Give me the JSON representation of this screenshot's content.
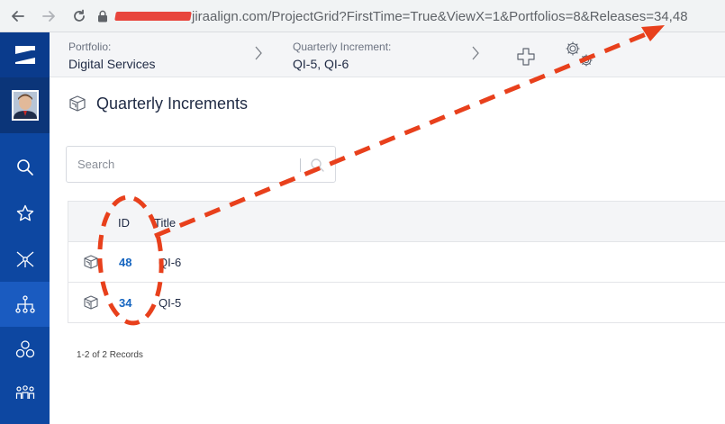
{
  "browser": {
    "url_domain": "jiraalign.com",
    "url_path": "/ProjectGrid?FirstTime=True&ViewX=1&Portfolios=8&Releases=34,48"
  },
  "breadcrumb": {
    "portfolio_label": "Portfolio:",
    "portfolio_value": "Digital Services",
    "qi_label": "Quarterly Increment:",
    "qi_value": "QI-5, QI-6"
  },
  "page": {
    "title": "Quarterly Increments"
  },
  "search": {
    "placeholder": "Search",
    "value": ""
  },
  "table": {
    "headers": {
      "id": "ID",
      "title": "Title"
    },
    "rows": [
      {
        "id": "48",
        "title": "QI-6"
      },
      {
        "id": "34",
        "title": "QI-5"
      }
    ],
    "records_text": "1-2 of 2 Records"
  },
  "sidebar": {
    "items": [
      {
        "icon": "search-icon"
      },
      {
        "icon": "star-icon"
      },
      {
        "icon": "network-icon"
      },
      {
        "icon": "hierarchy-icon",
        "active": true
      },
      {
        "icon": "cluster-icon"
      },
      {
        "icon": "people-icon"
      }
    ]
  },
  "annotation": {
    "color": "#e8401c"
  }
}
